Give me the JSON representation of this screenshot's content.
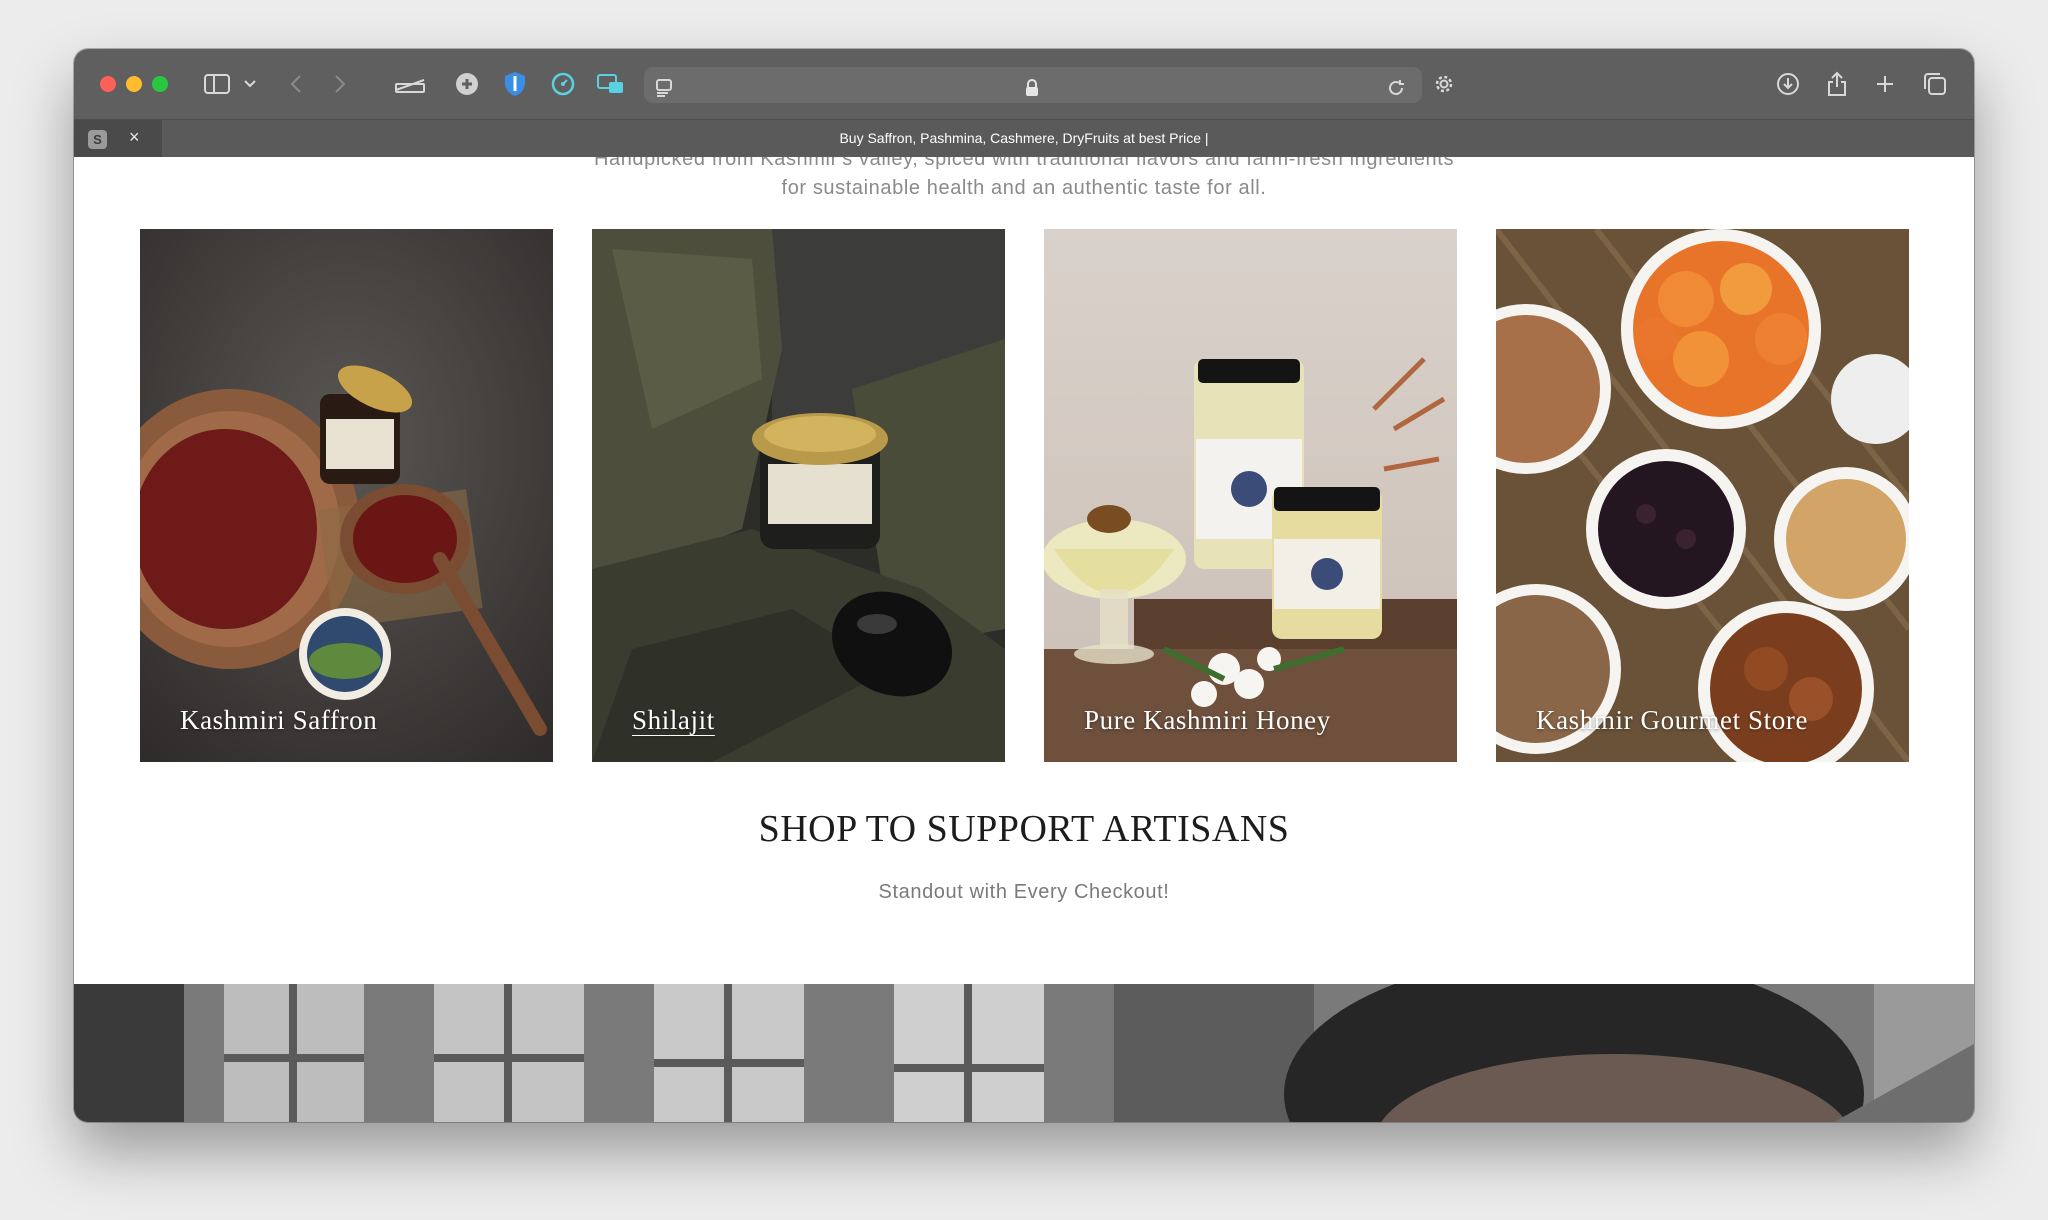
{
  "browser": {
    "tab_title": "Buy Saffron, Pashmina, Cashmere, DryFruits at best Price |",
    "favicon_letter": "S",
    "tab_close": "×"
  },
  "page": {
    "intro_line1": "Handpicked from Kashmir's valley, spiced with traditional flavors and farm-fresh ingredients",
    "intro_line2": "for sustainable health and an authentic taste for all.",
    "cards": [
      {
        "label": "Kashmiri Saffron"
      },
      {
        "label": "Shilajit"
      },
      {
        "label": "Pure Kashmiri Honey"
      },
      {
        "label": "Kashmir Gourmet Store"
      }
    ],
    "section_title": "SHOP TO SUPPORT ARTISANS",
    "section_subtitle": "Standout with Every Checkout!"
  },
  "colors": {
    "toolbar": "#5f5f5f",
    "accent_red": "#fe5f57",
    "accent_yellow": "#febc2e",
    "accent_green": "#28c840"
  }
}
